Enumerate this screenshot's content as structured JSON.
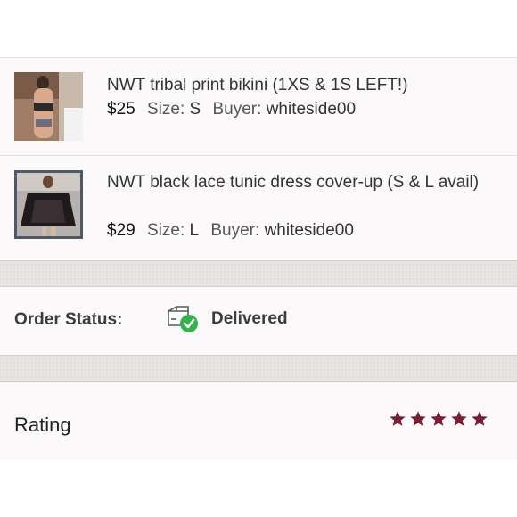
{
  "items": [
    {
      "title": "NWT tribal print bikini (1XS & 1S LEFT!)",
      "price": "$25",
      "size_label": "Size:",
      "size": "S",
      "buyer_label": "Buyer:",
      "buyer": "whiteside00"
    },
    {
      "title": "NWT black lace tunic dress cover-up (S & L avail)",
      "price": "$29",
      "size_label": "Size:",
      "size": "L",
      "buyer_label": "Buyer:",
      "buyer": "whiteside00"
    }
  ],
  "order_status": {
    "label": "Order Status:",
    "value": "Delivered",
    "icon": "delivered-box-check-icon"
  },
  "rating": {
    "label": "Rating",
    "stars": 5,
    "max": 5,
    "star_color": "#7a1f33"
  },
  "colors": {
    "check_green": "#2fb34a",
    "band": "#e4e0de"
  }
}
